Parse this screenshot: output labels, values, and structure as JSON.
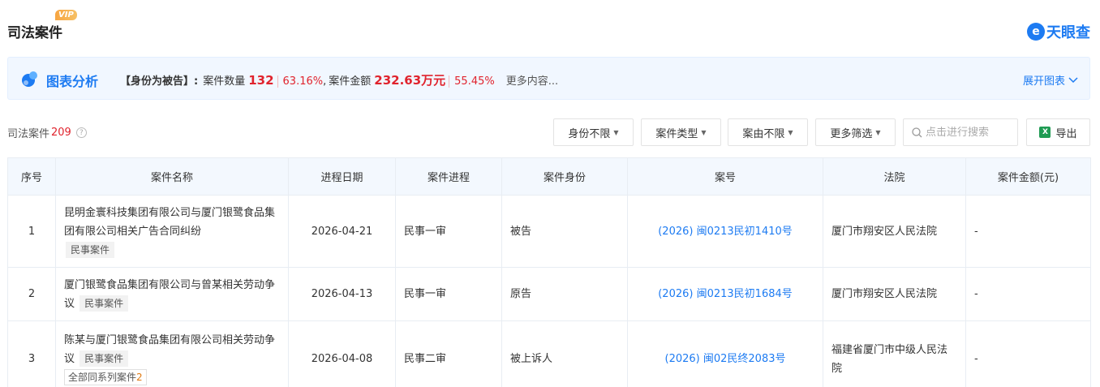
{
  "header": {
    "title": "司法案件",
    "vip_badge": "VIP",
    "logo_text": "天眼查",
    "logo_mark": "e"
  },
  "analysis": {
    "title": "图表分析",
    "role": "【身份为被告】:",
    "count_label": "案件数量",
    "count_value": "132",
    "count_pct": "63.16%",
    "separator": ",",
    "amount_label": "案件金额",
    "amount_value": "232.63万元",
    "amount_pct": "55.45%",
    "more": "更多内容...",
    "expand": "展开图表",
    "accent": "#1d7bf2",
    "highlight": "#e0232d"
  },
  "toolbar": {
    "count_label": "司法案件",
    "count": "209",
    "filters": [
      "身份不限",
      "案件类型",
      "案由不限",
      "更多筛选"
    ],
    "search_placeholder": "点击进行搜索",
    "export_label": "导出"
  },
  "table": {
    "columns": [
      "序号",
      "案件名称",
      "进程日期",
      "案件进程",
      "案件身份",
      "案号",
      "法院",
      "案件金额(元)"
    ],
    "rows": [
      {
        "index": "1",
        "name": "昆明金寰科技集团有限公司与厦门银鹭食品集团有限公司相关广告合同纠纷",
        "tag": "民事案件",
        "date": "2026-04-21",
        "stage": "民事一审",
        "role": "被告",
        "case_no": "(2026) 闽0213民初1410号",
        "court": "厦门市翔安区人民法院",
        "amount": "-"
      },
      {
        "index": "2",
        "name": "厦门银鹭食品集团有限公司与曾某相关劳动争议",
        "tag": "民事案件",
        "date": "2026-04-13",
        "stage": "民事一审",
        "role": "原告",
        "case_no": "(2026) 闽0213民初1684号",
        "court": "厦门市翔安区人民法院",
        "amount": "-"
      },
      {
        "index": "3",
        "name": "陈某与厦门银鹭食品集团有限公司相关劳动争议",
        "tag": "民事案件",
        "series_label": "全部同系列案件",
        "series_count": "2",
        "date": "2026-04-08",
        "stage": "民事二审",
        "role": "被上诉人",
        "case_no": "(2026) 闽02民终2083号",
        "court": "福建省厦门市中级人民法院",
        "amount": "-"
      }
    ]
  }
}
